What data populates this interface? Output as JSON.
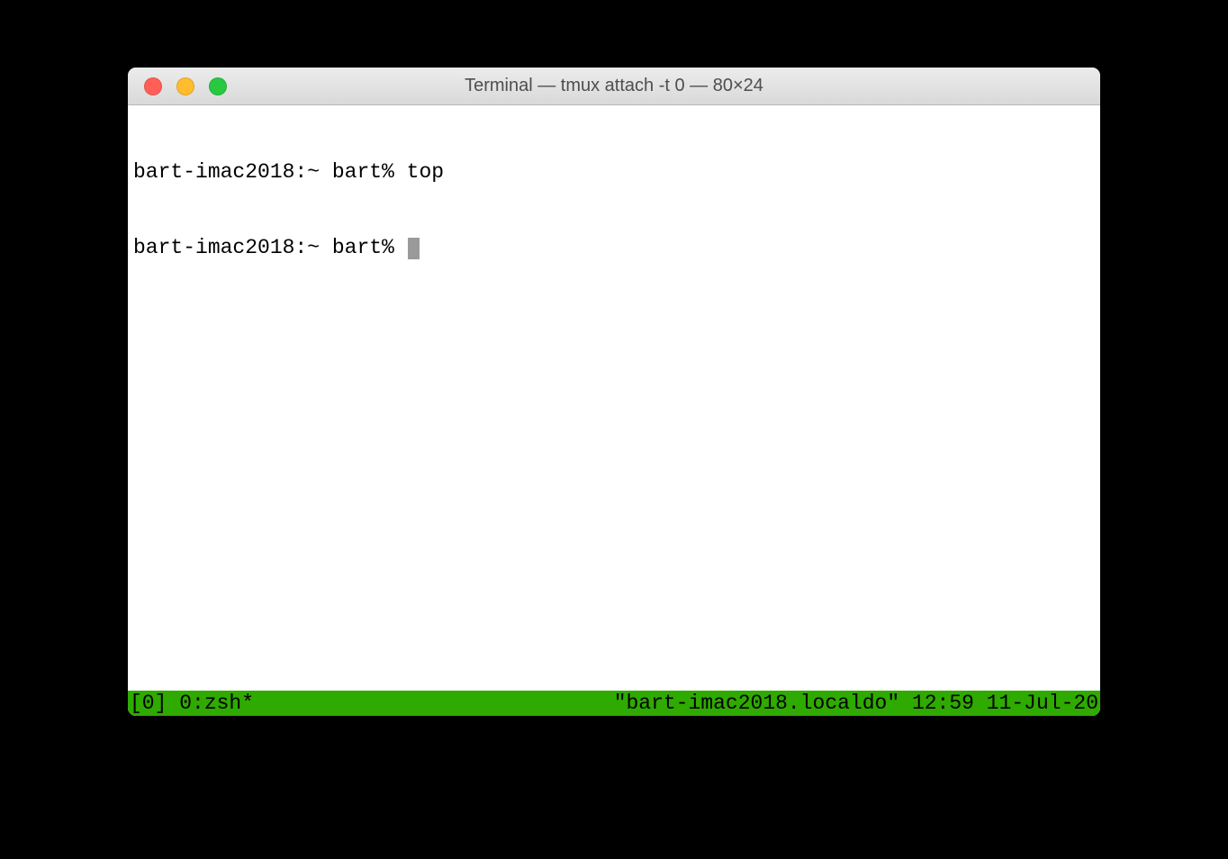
{
  "window": {
    "title": "Terminal — tmux attach -t 0 — 80×24"
  },
  "terminal": {
    "lines": [
      {
        "prompt": "bart-imac2018:~ bart% ",
        "command": "top",
        "has_cursor": false
      },
      {
        "prompt": "bart-imac2018:~ bart% ",
        "command": "",
        "has_cursor": true
      }
    ]
  },
  "tmux": {
    "left": "[0] 0:zsh*",
    "right": "\"bart-imac2018.localdo\" 12:59 11-Jul-20"
  }
}
